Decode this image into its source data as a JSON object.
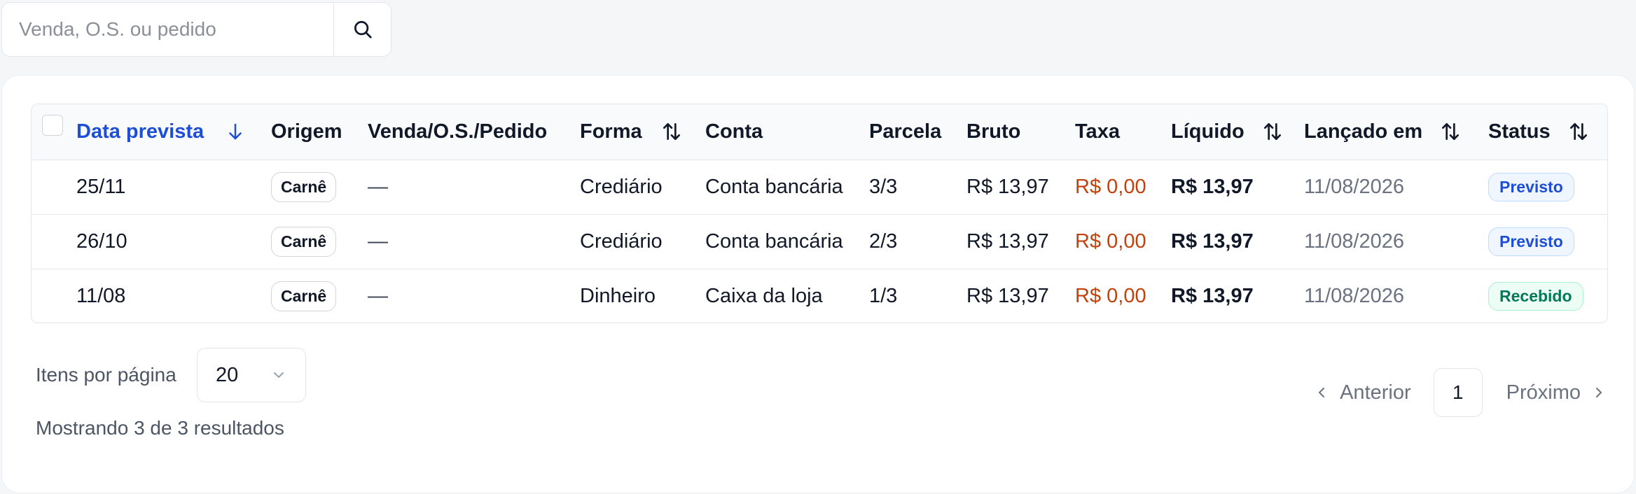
{
  "search": {
    "placeholder": "Venda, O.S. ou pedido"
  },
  "table": {
    "headers": {
      "date": "Data prevista",
      "origin": "Origem",
      "ref": "Venda/O.S./Pedido",
      "method": "Forma",
      "account": "Conta",
      "installment": "Parcela",
      "gross": "Bruto",
      "fee": "Taxa",
      "net": "Líquido",
      "posted": "Lançado em",
      "status": "Status"
    },
    "rows": [
      {
        "date": "25/11",
        "origin": "Carnê",
        "ref": "—",
        "method": "Crediário",
        "account": "Conta bancária",
        "installment": "3/3",
        "gross": "R$ 13,97",
        "fee": "R$ 0,00",
        "net": "R$ 13,97",
        "posted": "11/08/2026",
        "status": "Previsto"
      },
      {
        "date": "26/10",
        "origin": "Carnê",
        "ref": "—",
        "method": "Crediário",
        "account": "Conta bancária",
        "installment": "2/3",
        "gross": "R$ 13,97",
        "fee": "R$ 0,00",
        "net": "R$ 13,97",
        "posted": "11/08/2026",
        "status": "Previsto"
      },
      {
        "date": "11/08",
        "origin": "Carnê",
        "ref": "—",
        "method": "Dinheiro",
        "account": "Caixa da loja",
        "installment": "1/3",
        "gross": "R$ 13,97",
        "fee": "R$ 0,00",
        "net": "R$ 13,97",
        "posted": "11/08/2026",
        "status": "Recebido"
      }
    ]
  },
  "footer": {
    "items_per_page_label": "Itens por página",
    "items_per_page_value": "20",
    "showing": "Mostrando 3 de 3 resultados",
    "prev_label": "Anterior",
    "next_label": "Próximo",
    "current_page": "1"
  },
  "colors": {
    "accent": "#1d4ed8",
    "fee": "#c2410c",
    "status_previsto": "#1d4ed8",
    "status_recebido": "#047857"
  }
}
